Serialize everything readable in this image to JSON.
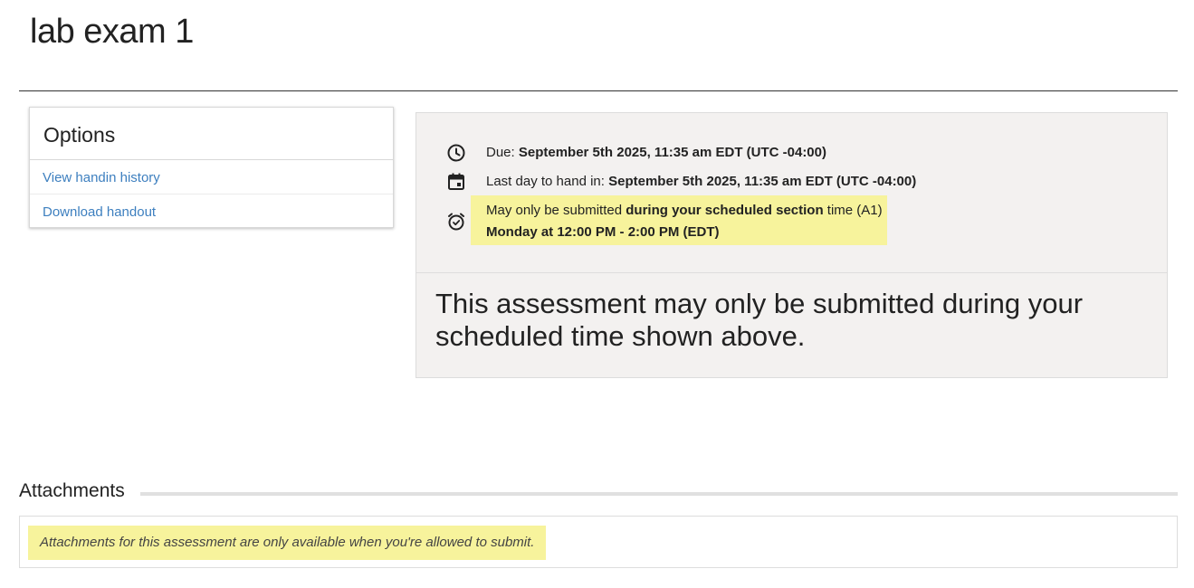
{
  "page": {
    "title": "lab exam 1"
  },
  "options": {
    "header": "Options",
    "links": [
      {
        "label": "View handin history"
      },
      {
        "label": "Download handout"
      }
    ]
  },
  "info": {
    "due_label": "Due: ",
    "due_value": "September 5th 2025, 11:35 am EDT (UTC -04:00)",
    "last_day_label": "Last day to hand in: ",
    "last_day_value": "September 5th 2025, 11:35 am EDT (UTC -04:00)",
    "section_prefix": "May only be submitted ",
    "section_bold": "during your scheduled section",
    "section_suffix": " time (A1)",
    "section_schedule": "Monday at 12:00 PM - 2:00 PM (EDT)",
    "message": "This assessment may only be submitted during your scheduled time shown above."
  },
  "attachments": {
    "title": "Attachments",
    "note": "Attachments for this assessment are only available when you're allowed to submit."
  },
  "icons": {
    "due": "clock-icon",
    "last_day": "calendar-icon",
    "section": "alarm-clock-icon"
  },
  "colors": {
    "link": "#3d7fbf",
    "highlight": "#f7f39c",
    "card_bg": "#f3f1f0"
  }
}
